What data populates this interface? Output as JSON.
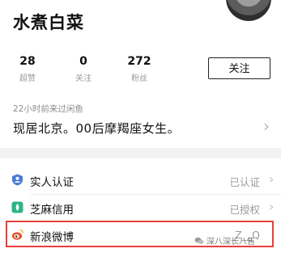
{
  "profile": {
    "name": "水煮白菜",
    "stats": [
      {
        "value": "28",
        "label": "超赞"
      },
      {
        "value": "0",
        "label": "关注"
      },
      {
        "value": "272",
        "label": "粉丝"
      }
    ],
    "follow_label": "关注",
    "last_visit": "22小时前来过闲鱼",
    "bio": "现居北京。00后摩羯座女生。"
  },
  "verifications": [
    {
      "label": "实人认证",
      "value": "已认证",
      "icon": "shield-icon",
      "color": "#4a7bd6"
    },
    {
      "label": "芝麻信用",
      "value": "已授权",
      "icon": "sesame-icon",
      "color": "#2fb388"
    },
    {
      "label": "新浪微博",
      "value": "Z__Q",
      "icon": "weibo-icon",
      "color": "#e8512b"
    }
  ],
  "watermark": "深八深长八售",
  "highlight_color": "#e8403a"
}
